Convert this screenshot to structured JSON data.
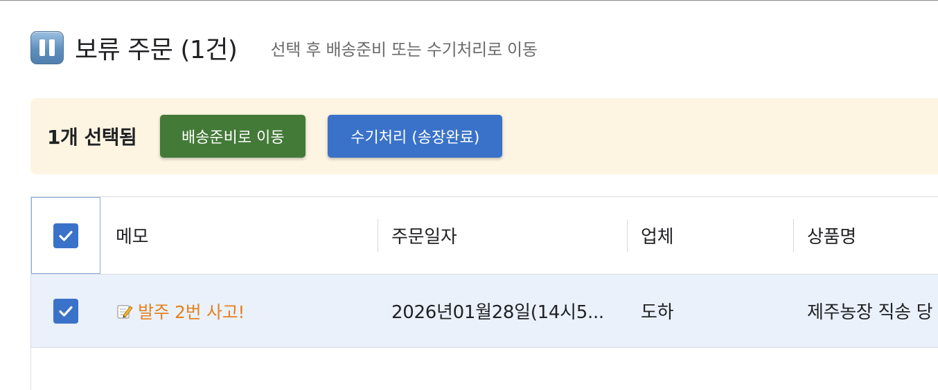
{
  "header": {
    "title": "보류 주문 (1건)",
    "subtitle": "선택 후 배송준비 또는 수기처리로 이동",
    "icon": "pause-icon"
  },
  "action_bar": {
    "selected_count": "1개 선택됨",
    "move_to_shipping_label": "배송준비로 이동",
    "manual_process_label": "수기처리 (송장완료)"
  },
  "table": {
    "select_all_checked": true,
    "columns": [
      "메모",
      "주문일자",
      "업체",
      "상품명"
    ],
    "rows": [
      {
        "checked": true,
        "memo_icon": "memo-pencil-icon",
        "memo": "발주 2번 사고!",
        "order_date": "2026년01월28일(14시5...",
        "vendor": "도하",
        "product": "제주농장 직송 당"
      }
    ]
  },
  "colors": {
    "accent_blue": "#3a72c9",
    "accent_green": "#447a38",
    "action_bar_bg": "#fdf4e2",
    "memo_orange": "#e5801e",
    "selected_row_bg": "#eaf1fb"
  }
}
